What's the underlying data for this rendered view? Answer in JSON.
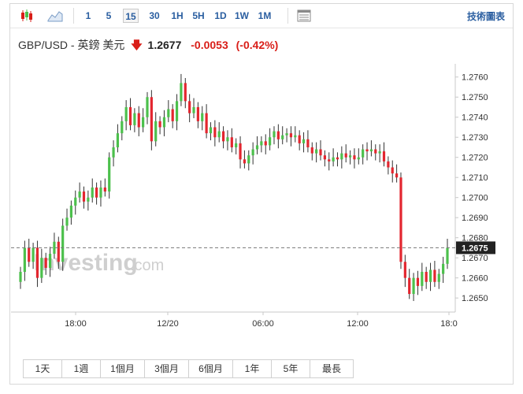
{
  "toolbar": {
    "intervals": [
      "1",
      "5",
      "15",
      "30",
      "1H",
      "5H",
      "1D",
      "1W",
      "1M"
    ],
    "active_interval": "15",
    "technical_chart_label": "技術圖表"
  },
  "quote": {
    "symbol": "GBP/USD - 英鎊 美元",
    "price": "1.2677",
    "change": "-0.0053",
    "change_pct": "(-0.42%)",
    "direction_icon": "down-arrow-icon"
  },
  "watermark": {
    "brand": "Investing",
    "suffix": ".com"
  },
  "ranges": [
    "1天",
    "1週",
    "1個月",
    "3個月",
    "6個月",
    "1年",
    "5年",
    "最長"
  ],
  "colors": {
    "up": "#4cc04c",
    "down": "#e3262f",
    "link": "#2a5ea0",
    "price_tag": "#222222"
  },
  "chart_data": {
    "type": "candlestick",
    "x_tick_labels": [
      "18:00",
      "12/20",
      "06:00",
      "12:00",
      "18:0"
    ],
    "y_tick_labels": [
      "1.2760",
      "1.2750",
      "1.2740",
      "1.2730",
      "1.2720",
      "1.2710",
      "1.2700",
      "1.2690",
      "1.2680",
      "1.2670",
      "1.2660",
      "1.2650"
    ],
    "ylim": [
      1.2643,
      1.2765
    ],
    "current_price_label": "1.2675",
    "reference_line": 1.2675,
    "candles": [
      [
        1.2658,
        1.2663
      ],
      [
        1.2663,
        1.2675
      ],
      [
        1.2675,
        1.2668
      ],
      [
        1.2668,
        1.2675
      ],
      [
        1.2675,
        1.266
      ],
      [
        1.266,
        1.267
      ],
      [
        1.267,
        1.2665
      ],
      [
        1.2665,
        1.2672
      ],
      [
        1.2672,
        1.2678
      ],
      [
        1.2678,
        1.2668
      ],
      [
        1.2668,
        1.2686
      ],
      [
        1.2686,
        1.269
      ],
      [
        1.269,
        1.2696
      ],
      [
        1.2696,
        1.27
      ],
      [
        1.27,
        1.2703
      ],
      [
        1.2703,
        1.2698
      ],
      [
        1.2698,
        1.27
      ],
      [
        1.27,
        1.2705
      ],
      [
        1.2705,
        1.27
      ],
      [
        1.27,
        1.2705
      ],
      [
        1.2705,
        1.2703
      ],
      [
        1.2703,
        1.272
      ],
      [
        1.272,
        1.2725
      ],
      [
        1.2725,
        1.2732
      ],
      [
        1.2732,
        1.2738
      ],
      [
        1.2738,
        1.2745
      ],
      [
        1.2745,
        1.2736
      ],
      [
        1.2736,
        1.2742
      ],
      [
        1.2742,
        1.2735
      ],
      [
        1.2735,
        1.274
      ],
      [
        1.274,
        1.275
      ],
      [
        1.275,
        1.2728
      ],
      [
        1.2728,
        1.2738
      ],
      [
        1.2738,
        1.2735
      ],
      [
        1.2735,
        1.274
      ],
      [
        1.274,
        1.2744
      ],
      [
        1.2744,
        1.2738
      ],
      [
        1.2738,
        1.2748
      ],
      [
        1.2748,
        1.2757
      ],
      [
        1.2757,
        1.2748
      ],
      [
        1.2748,
        1.2742
      ],
      [
        1.2742,
        1.2745
      ],
      [
        1.2745,
        1.2738
      ],
      [
        1.2738,
        1.2742
      ],
      [
        1.2742,
        1.2732
      ],
      [
        1.2732,
        1.2735
      ],
      [
        1.2735,
        1.273
      ],
      [
        1.273,
        1.2733
      ],
      [
        1.2733,
        1.2728
      ],
      [
        1.2728,
        1.273
      ],
      [
        1.273,
        1.2725
      ],
      [
        1.2725,
        1.2727
      ],
      [
        1.2727,
        1.2719
      ],
      [
        1.2719,
        1.2717
      ],
      [
        1.2717,
        1.2721
      ],
      [
        1.2721,
        1.2724
      ],
      [
        1.2724,
        1.2726
      ],
      [
        1.2726,
        1.2728
      ],
      [
        1.2728,
        1.2726
      ],
      [
        1.2726,
        1.273
      ],
      [
        1.273,
        1.2733
      ],
      [
        1.2733,
        1.2729
      ],
      [
        1.2729,
        1.2731
      ],
      [
        1.2731,
        1.2732
      ],
      [
        1.2732,
        1.273
      ],
      [
        1.273,
        1.2731
      ],
      [
        1.2731,
        1.2727
      ],
      [
        1.2727,
        1.2729
      ],
      [
        1.2729,
        1.2725
      ],
      [
        1.2725,
        1.2722
      ],
      [
        1.2722,
        1.2724
      ],
      [
        1.2724,
        1.2721
      ],
      [
        1.2721,
        1.2719
      ],
      [
        1.2719,
        1.2718
      ],
      [
        1.2718,
        1.272
      ],
      [
        1.272,
        1.2719
      ],
      [
        1.2719,
        1.2722
      ],
      [
        1.2722,
        1.272
      ],
      [
        1.272,
        1.2721
      ],
      [
        1.2721,
        1.2719
      ],
      [
        1.2719,
        1.272
      ],
      [
        1.272,
        1.2724
      ],
      [
        1.2724,
        1.2723
      ],
      [
        1.2723,
        1.2724
      ],
      [
        1.2724,
        1.2722
      ],
      [
        1.2722,
        1.2723
      ],
      [
        1.2723,
        1.2718
      ],
      [
        1.2718,
        1.2715
      ],
      [
        1.2715,
        1.2712
      ],
      [
        1.2712,
        1.271
      ],
      [
        1.271,
        1.2668
      ],
      [
        1.2668,
        1.266
      ],
      [
        1.266,
        1.2652
      ],
      [
        1.2652,
        1.266
      ],
      [
        1.266,
        1.2656
      ],
      [
        1.2656,
        1.2663
      ],
      [
        1.2663,
        1.2658
      ],
      [
        1.2658,
        1.2664
      ],
      [
        1.2664,
        1.2658
      ],
      [
        1.2658,
        1.2662
      ],
      [
        1.2662,
        1.2667
      ],
      [
        1.2667,
        1.2675
      ]
    ]
  }
}
